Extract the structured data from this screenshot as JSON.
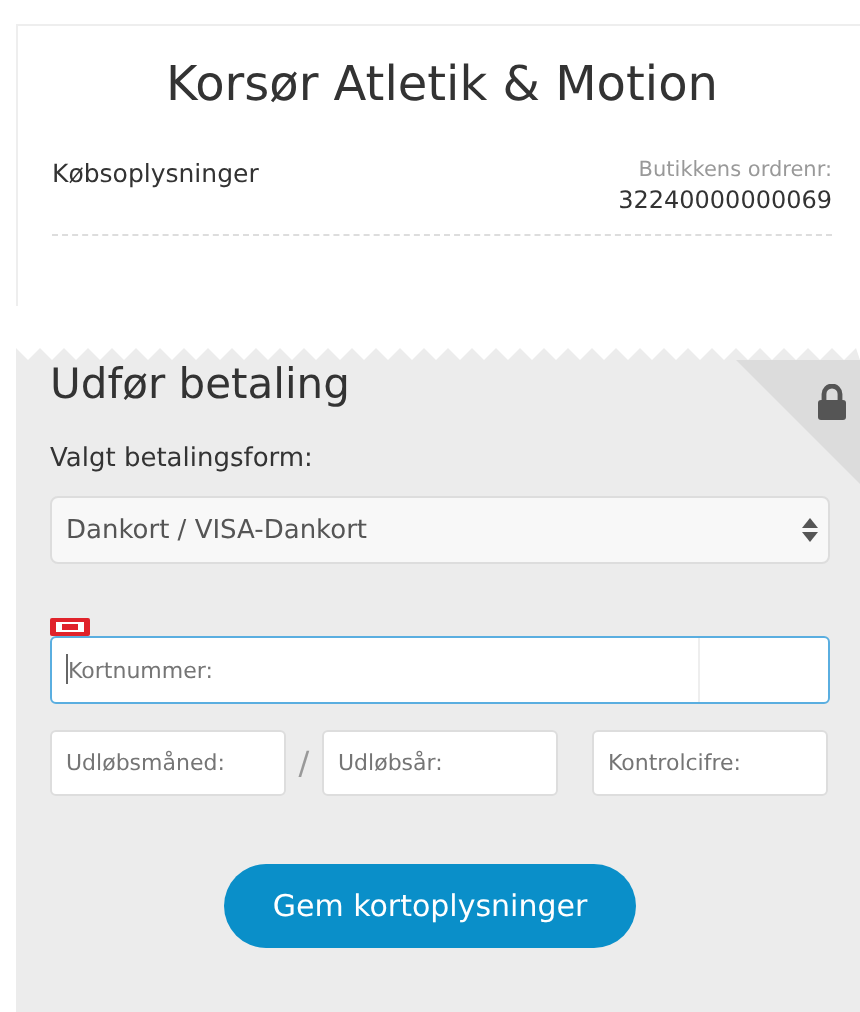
{
  "shop_title": "Korsør Atletik & Motion",
  "purchase_info": {
    "label": "Købsoplysninger",
    "order_label": "Butikkens ordrenr:",
    "order_number": "32240000000069"
  },
  "payment": {
    "heading": "Udfør betaling",
    "method_label": "Valgt betalingsform:",
    "method_value": "Dankort / VISA-Dankort",
    "card_number": {
      "placeholder": "Kortnummer:",
      "focused": true
    },
    "expiry_month": {
      "placeholder": "Udløbsmåned:"
    },
    "separator": "/",
    "expiry_year": {
      "placeholder": "Udløbsår:"
    },
    "cvc": {
      "placeholder": "Kontrolcifre:"
    },
    "submit": "Gem kortoplysninger"
  }
}
